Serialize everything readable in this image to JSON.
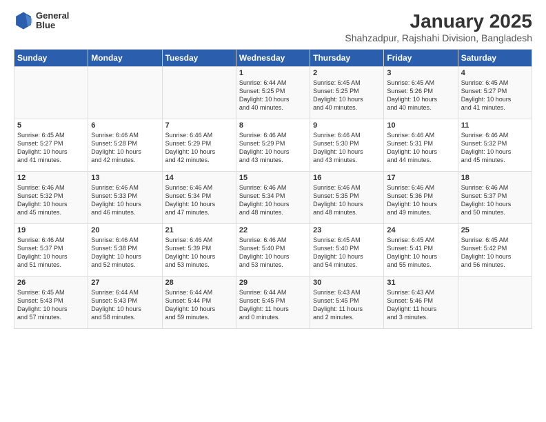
{
  "logo": {
    "line1": "General",
    "line2": "Blue"
  },
  "title": "January 2025",
  "subtitle": "Shahzadpur, Rajshahi Division, Bangladesh",
  "weekdays": [
    "Sunday",
    "Monday",
    "Tuesday",
    "Wednesday",
    "Thursday",
    "Friday",
    "Saturday"
  ],
  "weeks": [
    [
      {
        "day": "",
        "text": ""
      },
      {
        "day": "",
        "text": ""
      },
      {
        "day": "",
        "text": ""
      },
      {
        "day": "1",
        "text": "Sunrise: 6:44 AM\nSunset: 5:25 PM\nDaylight: 10 hours\nand 40 minutes."
      },
      {
        "day": "2",
        "text": "Sunrise: 6:45 AM\nSunset: 5:25 PM\nDaylight: 10 hours\nand 40 minutes."
      },
      {
        "day": "3",
        "text": "Sunrise: 6:45 AM\nSunset: 5:26 PM\nDaylight: 10 hours\nand 40 minutes."
      },
      {
        "day": "4",
        "text": "Sunrise: 6:45 AM\nSunset: 5:27 PM\nDaylight: 10 hours\nand 41 minutes."
      }
    ],
    [
      {
        "day": "5",
        "text": "Sunrise: 6:45 AM\nSunset: 5:27 PM\nDaylight: 10 hours\nand 41 minutes."
      },
      {
        "day": "6",
        "text": "Sunrise: 6:46 AM\nSunset: 5:28 PM\nDaylight: 10 hours\nand 42 minutes."
      },
      {
        "day": "7",
        "text": "Sunrise: 6:46 AM\nSunset: 5:29 PM\nDaylight: 10 hours\nand 42 minutes."
      },
      {
        "day": "8",
        "text": "Sunrise: 6:46 AM\nSunset: 5:29 PM\nDaylight: 10 hours\nand 43 minutes."
      },
      {
        "day": "9",
        "text": "Sunrise: 6:46 AM\nSunset: 5:30 PM\nDaylight: 10 hours\nand 43 minutes."
      },
      {
        "day": "10",
        "text": "Sunrise: 6:46 AM\nSunset: 5:31 PM\nDaylight: 10 hours\nand 44 minutes."
      },
      {
        "day": "11",
        "text": "Sunrise: 6:46 AM\nSunset: 5:32 PM\nDaylight: 10 hours\nand 45 minutes."
      }
    ],
    [
      {
        "day": "12",
        "text": "Sunrise: 6:46 AM\nSunset: 5:32 PM\nDaylight: 10 hours\nand 45 minutes."
      },
      {
        "day": "13",
        "text": "Sunrise: 6:46 AM\nSunset: 5:33 PM\nDaylight: 10 hours\nand 46 minutes."
      },
      {
        "day": "14",
        "text": "Sunrise: 6:46 AM\nSunset: 5:34 PM\nDaylight: 10 hours\nand 47 minutes."
      },
      {
        "day": "15",
        "text": "Sunrise: 6:46 AM\nSunset: 5:34 PM\nDaylight: 10 hours\nand 48 minutes."
      },
      {
        "day": "16",
        "text": "Sunrise: 6:46 AM\nSunset: 5:35 PM\nDaylight: 10 hours\nand 48 minutes."
      },
      {
        "day": "17",
        "text": "Sunrise: 6:46 AM\nSunset: 5:36 PM\nDaylight: 10 hours\nand 49 minutes."
      },
      {
        "day": "18",
        "text": "Sunrise: 6:46 AM\nSunset: 5:37 PM\nDaylight: 10 hours\nand 50 minutes."
      }
    ],
    [
      {
        "day": "19",
        "text": "Sunrise: 6:46 AM\nSunset: 5:37 PM\nDaylight: 10 hours\nand 51 minutes."
      },
      {
        "day": "20",
        "text": "Sunrise: 6:46 AM\nSunset: 5:38 PM\nDaylight: 10 hours\nand 52 minutes."
      },
      {
        "day": "21",
        "text": "Sunrise: 6:46 AM\nSunset: 5:39 PM\nDaylight: 10 hours\nand 53 minutes."
      },
      {
        "day": "22",
        "text": "Sunrise: 6:46 AM\nSunset: 5:40 PM\nDaylight: 10 hours\nand 53 minutes."
      },
      {
        "day": "23",
        "text": "Sunrise: 6:45 AM\nSunset: 5:40 PM\nDaylight: 10 hours\nand 54 minutes."
      },
      {
        "day": "24",
        "text": "Sunrise: 6:45 AM\nSunset: 5:41 PM\nDaylight: 10 hours\nand 55 minutes."
      },
      {
        "day": "25",
        "text": "Sunrise: 6:45 AM\nSunset: 5:42 PM\nDaylight: 10 hours\nand 56 minutes."
      }
    ],
    [
      {
        "day": "26",
        "text": "Sunrise: 6:45 AM\nSunset: 5:43 PM\nDaylight: 10 hours\nand 57 minutes."
      },
      {
        "day": "27",
        "text": "Sunrise: 6:44 AM\nSunset: 5:43 PM\nDaylight: 10 hours\nand 58 minutes."
      },
      {
        "day": "28",
        "text": "Sunrise: 6:44 AM\nSunset: 5:44 PM\nDaylight: 10 hours\nand 59 minutes."
      },
      {
        "day": "29",
        "text": "Sunrise: 6:44 AM\nSunset: 5:45 PM\nDaylight: 11 hours\nand 0 minutes."
      },
      {
        "day": "30",
        "text": "Sunrise: 6:43 AM\nSunset: 5:45 PM\nDaylight: 11 hours\nand 2 minutes."
      },
      {
        "day": "31",
        "text": "Sunrise: 6:43 AM\nSunset: 5:46 PM\nDaylight: 11 hours\nand 3 minutes."
      },
      {
        "day": "",
        "text": ""
      }
    ]
  ]
}
